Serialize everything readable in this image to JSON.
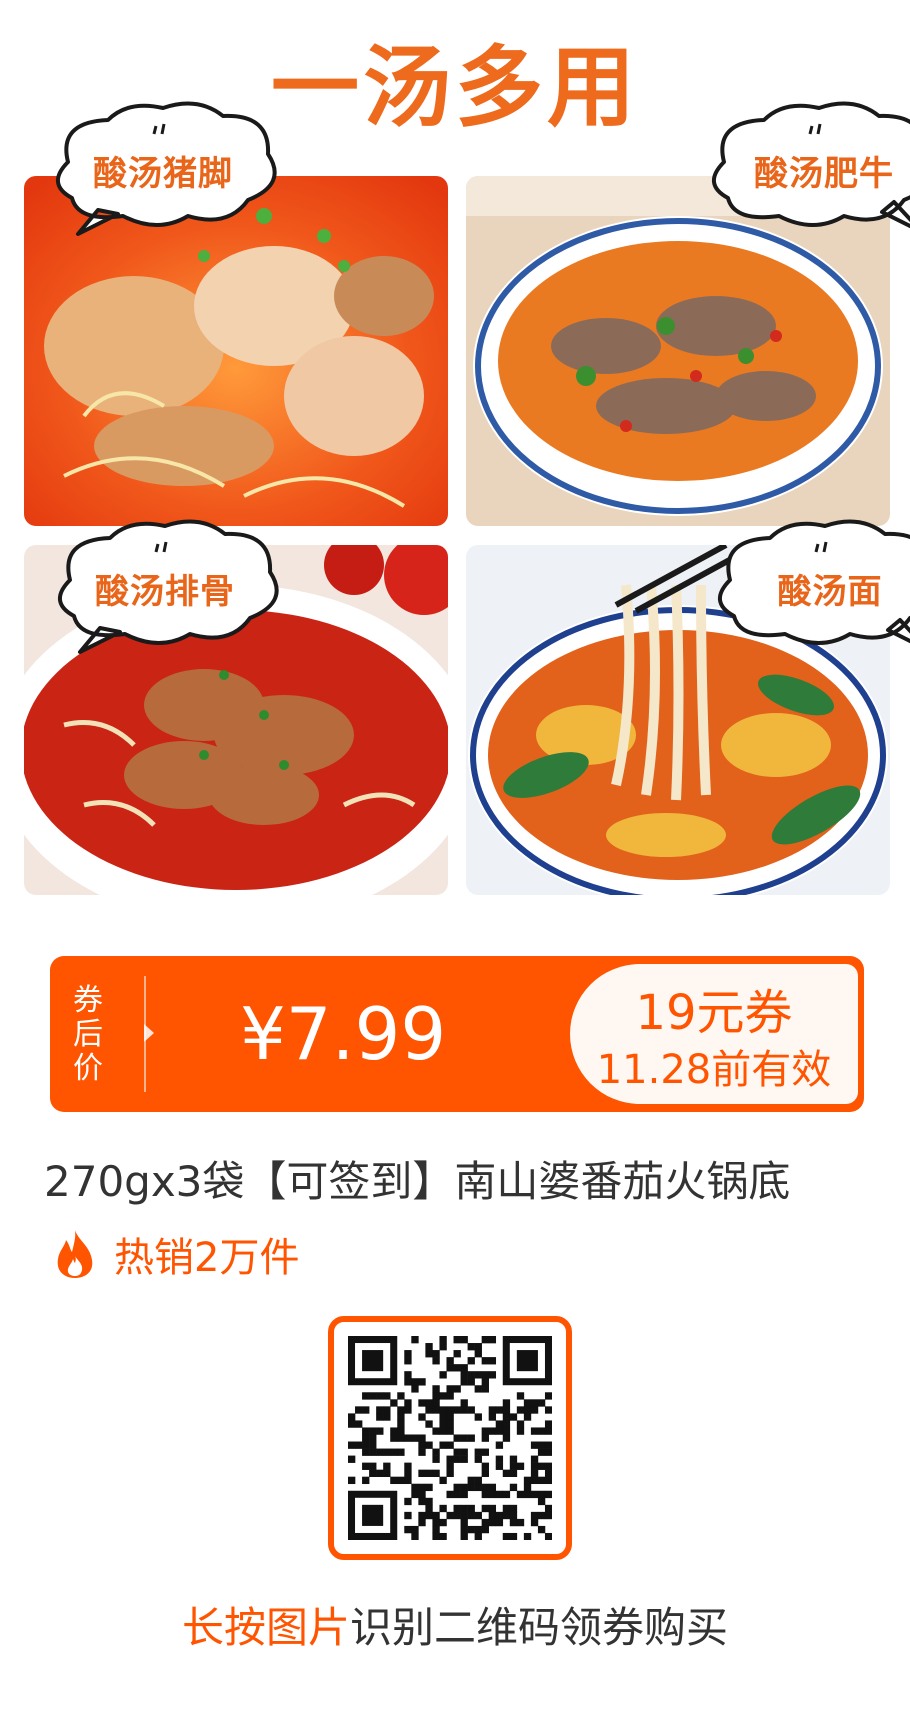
{
  "headline": "一汤多用",
  "dishes": [
    {
      "label": "酸汤猪脚"
    },
    {
      "label": "酸汤肥牛"
    },
    {
      "label": "酸汤排骨"
    },
    {
      "label": "酸汤面"
    }
  ],
  "coupon": {
    "label_chars": [
      "券",
      "后",
      "价"
    ],
    "price": "¥7.99",
    "voucher_amount": "19元券",
    "voucher_validity": "11.28前有效"
  },
  "product": {
    "title": "270gx3袋【可签到】南山婆番茄火锅底",
    "sales": "热销2万件"
  },
  "footer": {
    "highlight": "长按图片",
    "text": "识别二维码领券购买"
  },
  "icons": {
    "flame": "fire-icon",
    "qr": "qr-code"
  },
  "colors": {
    "accent": "#ff5400",
    "headline": "#ee6a1c",
    "text": "#333333"
  }
}
